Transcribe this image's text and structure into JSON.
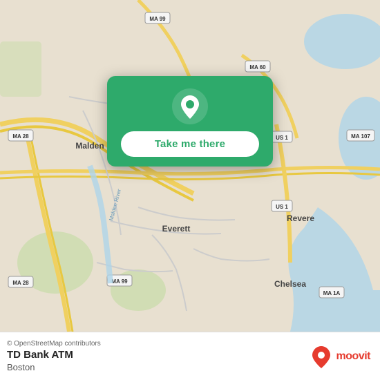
{
  "map": {
    "attribution": "© OpenStreetMap contributors",
    "background_color": "#e8e0d8"
  },
  "popup": {
    "button_label": "Take me there",
    "pin_color": "#ffffff"
  },
  "bottom_bar": {
    "attribution": "© OpenStreetMap contributors",
    "location_name": "TD Bank ATM",
    "location_city": "Boston",
    "moovit_label": "moovit"
  }
}
